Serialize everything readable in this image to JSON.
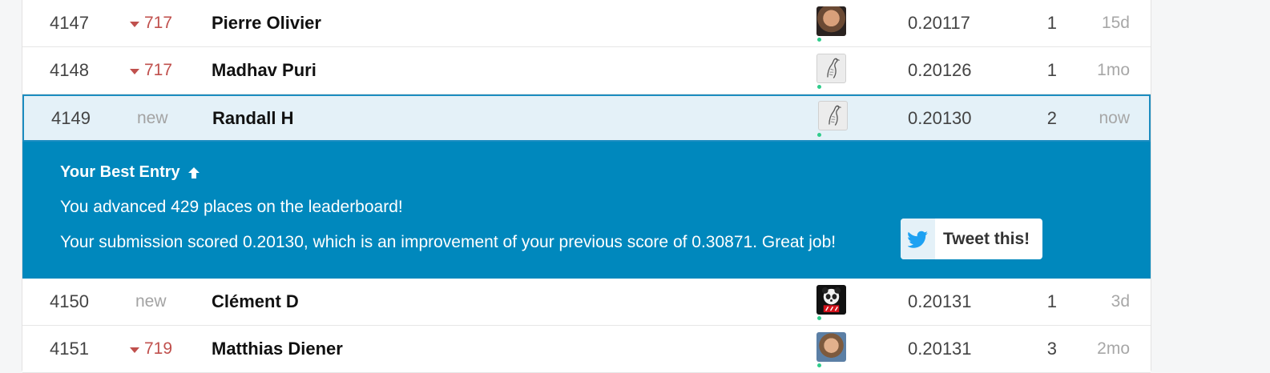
{
  "leaderboard": {
    "rows_before": [
      {
        "rank": "4147",
        "change": "717",
        "change_type": "down",
        "name": "Pierre Olivier",
        "avatar": "photo-avatar",
        "score": "0.20117",
        "entries": "1",
        "when": "15d"
      },
      {
        "rank": "4148",
        "change": "717",
        "change_type": "down",
        "name": "Madhav Puri",
        "avatar": "bird-avatar",
        "score": "0.20126",
        "entries": "1",
        "when": "1mo"
      }
    ],
    "self_row": {
      "rank": "4149",
      "change": "new",
      "change_type": "new",
      "name": "Randall H",
      "avatar": "bird-avatar",
      "score": "0.20130",
      "entries": "2",
      "when": "now"
    },
    "rows_after": [
      {
        "rank": "4150",
        "change": "new",
        "change_type": "new",
        "name": "Clément D",
        "avatar": "panda-avatar",
        "score": "0.20131",
        "entries": "1",
        "when": "3d"
      },
      {
        "rank": "4151",
        "change": "719",
        "change_type": "down",
        "name": "Matthias Diener",
        "avatar": "photo-avatar",
        "score": "0.20131",
        "entries": "3",
        "when": "2mo"
      }
    ]
  },
  "banner": {
    "title": "Your Best Entry",
    "title_icon": "arrow-up-icon",
    "line1": "You advanced 429 places on the leaderboard!",
    "line2": "Your submission scored 0.20130, which is an improvement of your previous score of 0.30871. Great job!",
    "tweet_label": "Tweet this!",
    "tweet_icon": "twitter-bird-icon"
  },
  "colors": {
    "banner_bg": "#0088bd",
    "self_row_bg": "#e4f1f8",
    "self_row_border": "#1b8cc0",
    "rank_down": "#c0504d",
    "online_dot": "#2fcc8b",
    "twitter_blue": "#1da1f2"
  }
}
